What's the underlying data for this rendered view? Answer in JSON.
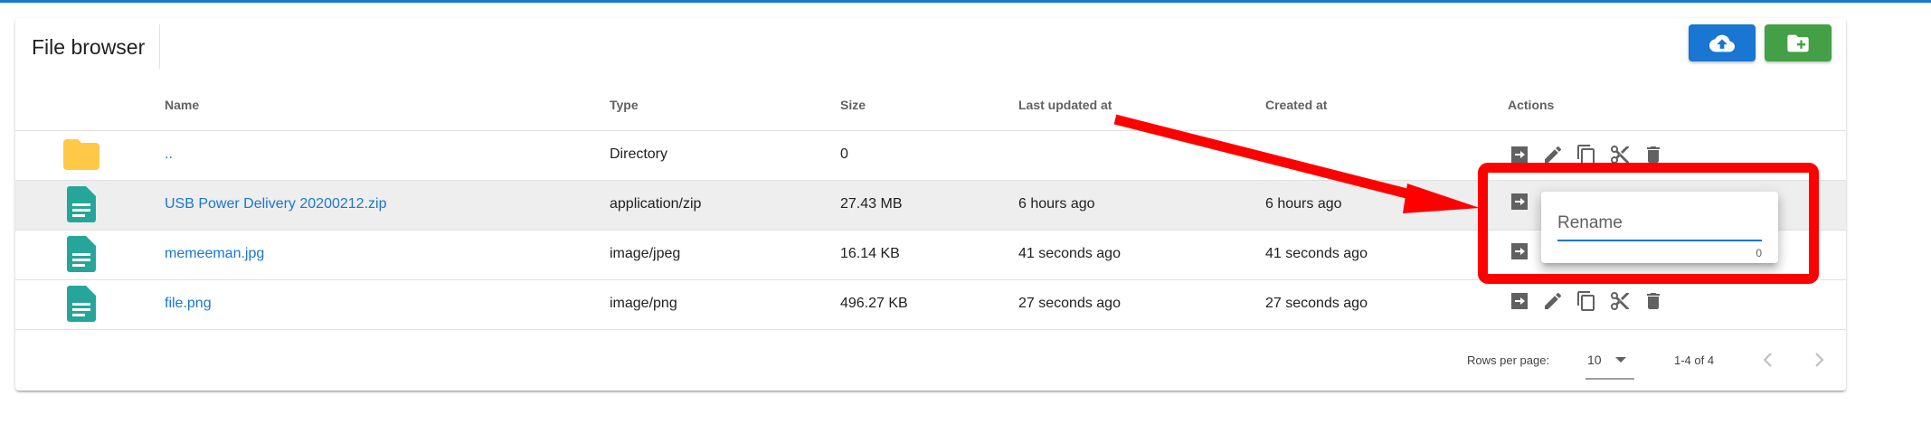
{
  "app": {
    "title": "File browser",
    "accent_color": "#1976d2",
    "upload_button": {
      "icon": "cloud-upload-icon",
      "color": "#1976d2"
    },
    "new_folder_button": {
      "icon": "create-new-folder-icon",
      "color": "#43a047"
    }
  },
  "table": {
    "headers": {
      "name": "Name",
      "type": "Type",
      "size": "Size",
      "updated": "Last updated at",
      "created": "Created at",
      "actions": "Actions"
    },
    "rows": [
      {
        "icon": "folder-icon",
        "name": "..",
        "type": "Directory",
        "size": "0",
        "updated": "",
        "created": ""
      },
      {
        "icon": "file-icon",
        "name": "USB Power Delivery 20200212.zip",
        "type": "application/zip",
        "size": "27.43 MB",
        "updated": "6 hours ago",
        "created": "6 hours ago"
      },
      {
        "icon": "file-icon",
        "name": "memeeman.jpg",
        "type": "image/jpeg",
        "size": "16.14 KB",
        "updated": "41 seconds ago",
        "created": "41 seconds ago"
      },
      {
        "icon": "file-icon",
        "name": "file.png",
        "type": "image/png",
        "size": "496.27 KB",
        "updated": "27 seconds ago",
        "created": "27 seconds ago"
      }
    ],
    "action_icons": [
      "open-icon",
      "edit-icon",
      "copy-icon",
      "cut-icon",
      "delete-icon"
    ]
  },
  "pagination": {
    "rows_per_page_label": "Rows per page:",
    "rows_per_page_value": "10",
    "range": "1-4 of 4"
  },
  "rename_popup": {
    "label": "Rename",
    "counter": "0"
  },
  "annotation": {
    "color": "#ff0000"
  }
}
